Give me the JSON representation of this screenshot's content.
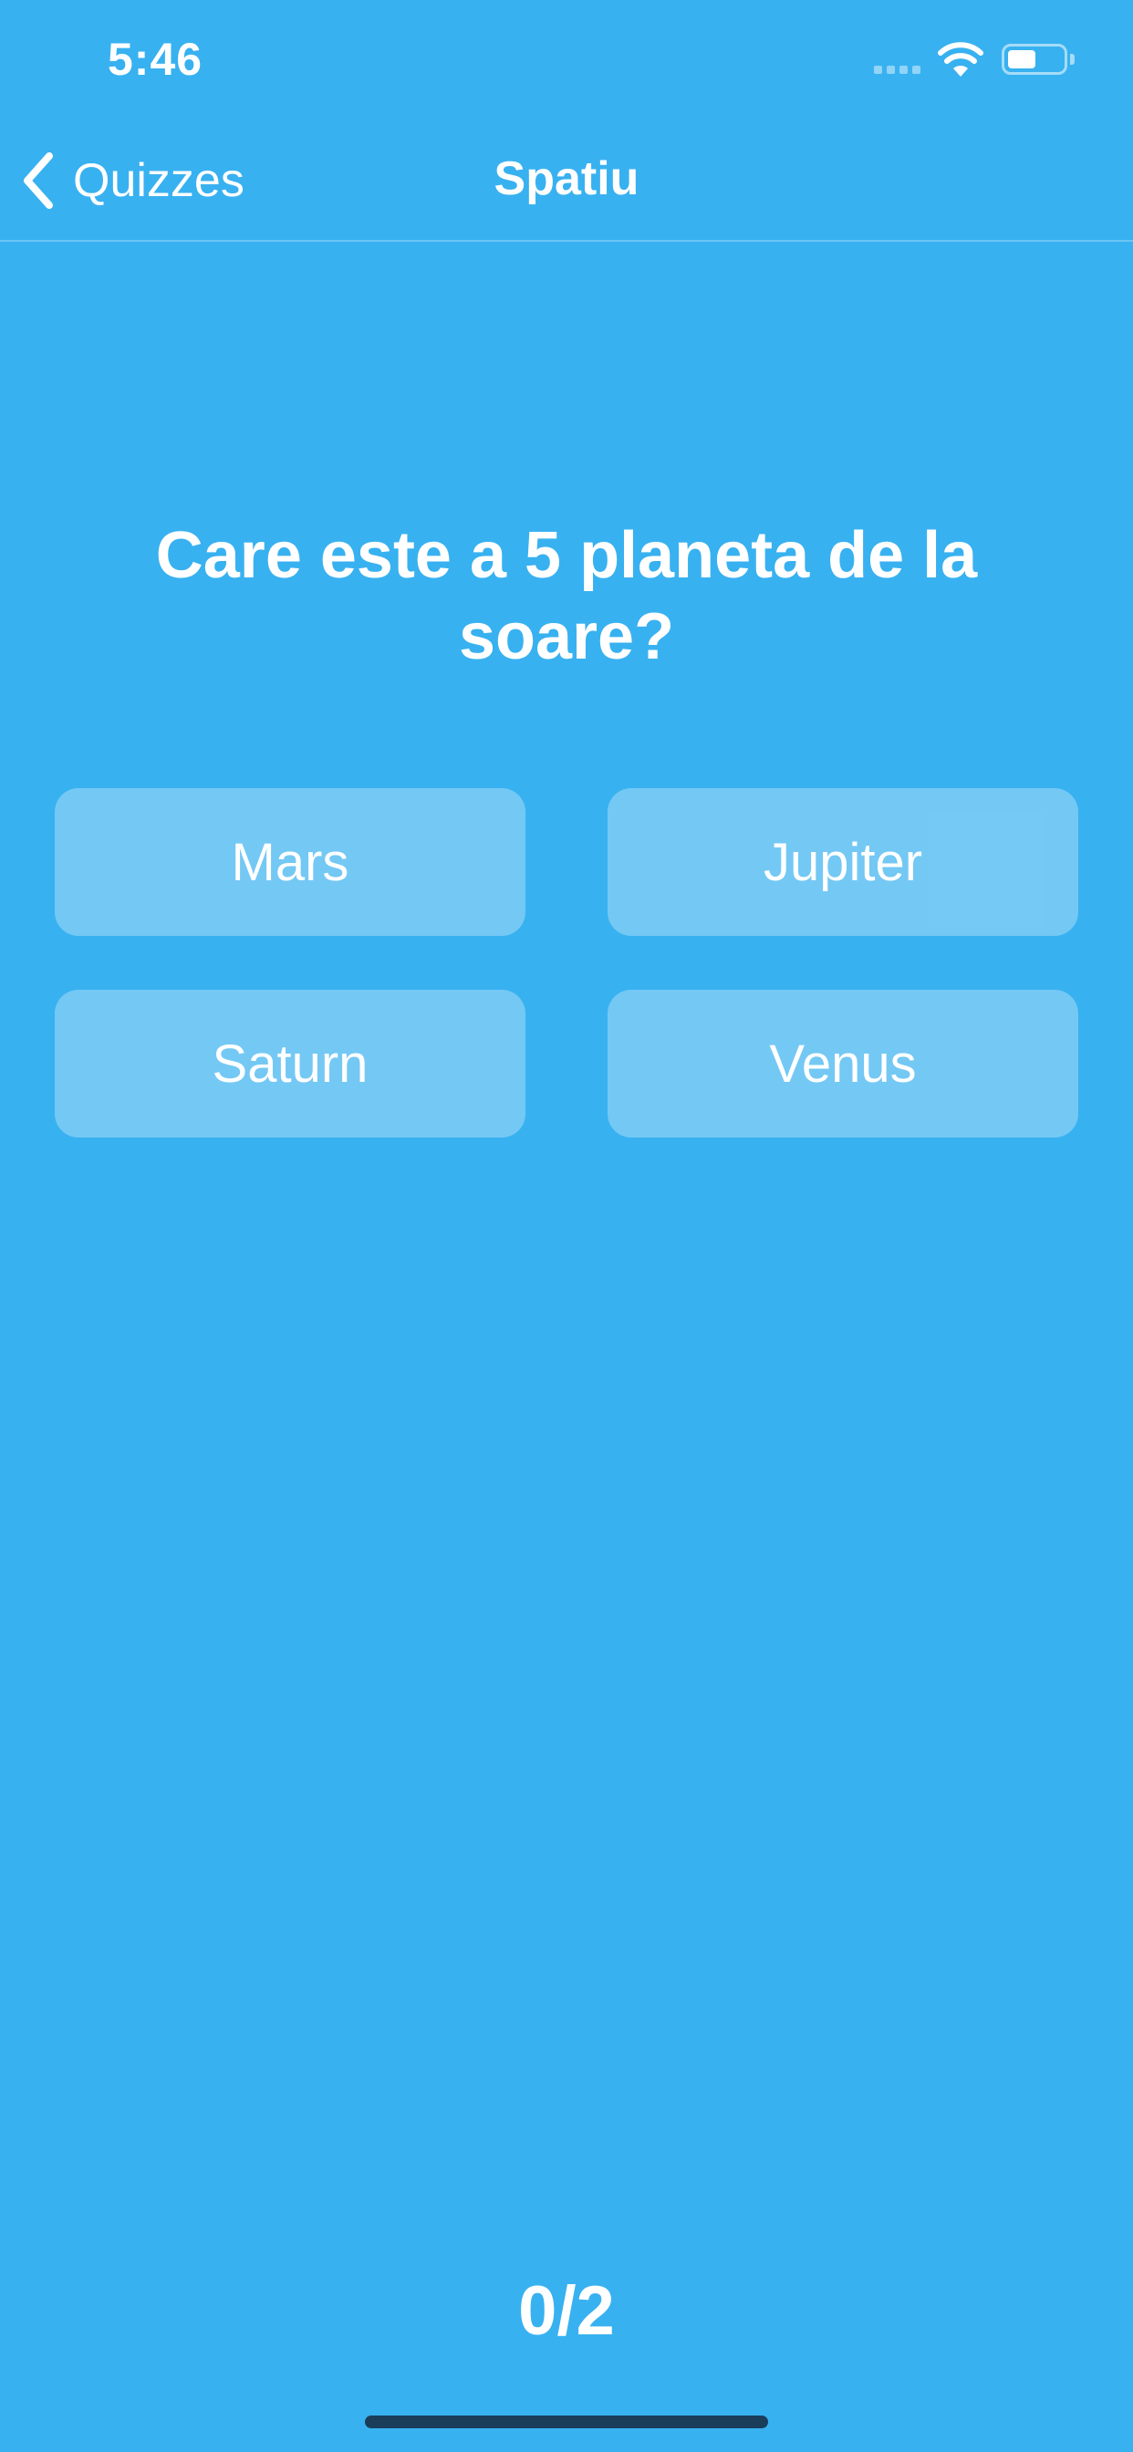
{
  "status_bar": {
    "time": "5:46",
    "icons": [
      "signal-icon",
      "wifi-icon",
      "battery-icon"
    ],
    "battery_level": 0.5
  },
  "nav": {
    "back_label": "Quizzes",
    "back_icon": "chevron-left-icon",
    "title": "Spatiu"
  },
  "quiz": {
    "question": "Care este a 5 planeta de la soare?",
    "answers": [
      {
        "label": "Mars"
      },
      {
        "label": "Jupiter"
      },
      {
        "label": "Saturn"
      },
      {
        "label": "Venus"
      }
    ],
    "score": "0/2"
  },
  "colors": {
    "background": "#38b1f0",
    "answer_bg": "rgba(255,255,255,0.3)",
    "text": "#ffffff"
  }
}
